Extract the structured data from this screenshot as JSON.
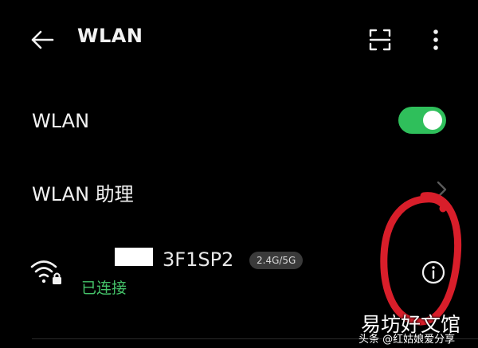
{
  "header": {
    "title": "WLAN",
    "back_icon": "arrow-left-icon",
    "scan_icon": "scan-icon",
    "more_icon": "more-vertical-icon"
  },
  "wlan_toggle": {
    "label": "WLAN",
    "state": "on",
    "color": "#2fbf5b"
  },
  "wlan_assistant": {
    "label": "WLAN 助理",
    "chevron_icon": "chevron-right-icon"
  },
  "network": {
    "ssid_visible": "3F1SP2",
    "band": "2.4G/5G",
    "status": "已连接",
    "status_color": "#45c46a",
    "wifi_icon": "wifi-locked-icon",
    "info_icon": "info-circle-icon"
  },
  "annotation": {
    "color": "#d81e2a",
    "shape": "hand-drawn-circle"
  },
  "watermark": {
    "main": "易坊好文馆",
    "sub": "头条 @红姑娘爱分享"
  }
}
